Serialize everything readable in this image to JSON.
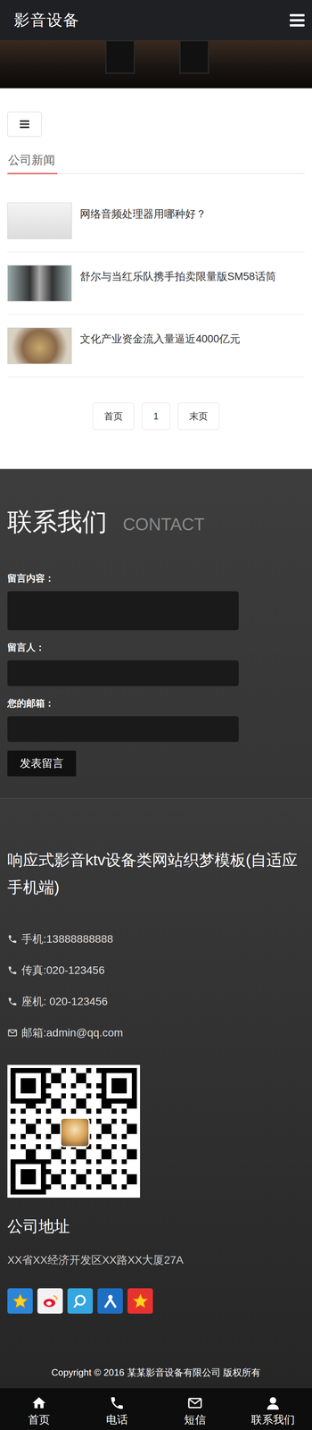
{
  "header": {
    "logo": "影音设备"
  },
  "section": {
    "title": "公司新闻"
  },
  "news": [
    {
      "title": "网络音频处理器用哪种好？"
    },
    {
      "title": "舒尔与当红乐队携手拍卖限量版SM58话筒"
    },
    {
      "title": "文化产业资金流入量逼近4000亿元"
    }
  ],
  "pagination": [
    {
      "label": "首页"
    },
    {
      "label": "1"
    },
    {
      "label": "末页"
    }
  ],
  "contact_form": {
    "title": "联系我们",
    "subtitle": "CONTACT",
    "fields": [
      {
        "label": "留言内容：",
        "kind": "textarea"
      },
      {
        "label": "留言人：",
        "kind": "input"
      },
      {
        "label": "您的邮箱：",
        "kind": "input"
      }
    ],
    "submit": "发表留言"
  },
  "footer": {
    "title": "响应式影音ktv设备类网站织梦模板(自适应手机端)",
    "contacts": [
      {
        "kind": "phone",
        "text": "手机:13888888888"
      },
      {
        "kind": "phone",
        "text": "传真:020-123456"
      },
      {
        "kind": "phone",
        "text": "座机: 020-123456"
      },
      {
        "kind": "mail",
        "text": "邮箱:admin@qq.com"
      }
    ],
    "address_title": "公司地址",
    "address": "XX省XX经济开发区XX路XX大厦27A",
    "social": [
      {
        "kind": "star",
        "color": "#2b86d8"
      },
      {
        "kind": "weibo",
        "color": "#f2f2f2"
      },
      {
        "kind": "ring",
        "color": "#35a6e0"
      },
      {
        "kind": "person",
        "color": "#1e6fc4"
      },
      {
        "kind": "star",
        "color": "#e8322f"
      }
    ],
    "copyright": "Copyright © 2016 某某影音设备有限公司 版权所有"
  },
  "bottom_nav": [
    {
      "kind": "home",
      "label": "首页"
    },
    {
      "kind": "phone",
      "label": "电话"
    },
    {
      "kind": "mail",
      "label": "短信"
    },
    {
      "kind": "user",
      "label": "联系我们"
    }
  ]
}
